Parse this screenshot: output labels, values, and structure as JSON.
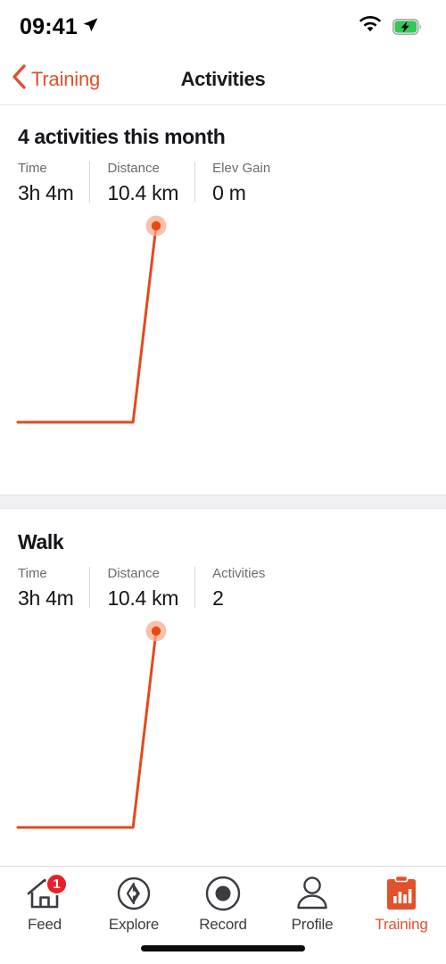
{
  "status_bar": {
    "time": "09:41",
    "location_icon": "location-arrow-icon",
    "wifi_icon": "wifi-icon",
    "battery_icon": "battery-charging-icon"
  },
  "nav": {
    "back_label": "Training",
    "back_icon": "chevron-left-icon",
    "title": "Activities"
  },
  "colors": {
    "accent": "#E1512A",
    "chart_line": "#E24A1D",
    "chart_marker": "#E84B12",
    "chart_marker_halo": "#F7A98B",
    "badge": "#E8202A",
    "battery": "#35C759",
    "text_primary": "#15151A",
    "text_secondary": "#6B6B73",
    "divider": "#D9D9DE",
    "band": "#F1F1F4"
  },
  "sections": [
    {
      "heading": "4 activities this month",
      "stats": [
        {
          "label": "Time",
          "value": "3h 4m"
        },
        {
          "label": "Distance",
          "value": "10.4 km"
        },
        {
          "label": "Elev Gain",
          "value": "0 m"
        }
      ]
    },
    {
      "heading": "Walk",
      "stats": [
        {
          "label": "Time",
          "value": "3h 4m"
        },
        {
          "label": "Distance",
          "value": "10.4 km"
        },
        {
          "label": "Activities",
          "value": "2"
        }
      ]
    }
  ],
  "chart_data": [
    {
      "type": "line",
      "title": "4 activities this month",
      "x": [
        0,
        1,
        2,
        3,
        4,
        5,
        6
      ],
      "values": [
        0,
        0,
        0,
        0,
        0,
        0,
        10.4
      ],
      "ylabel": "",
      "xlabel": "",
      "ylim": [
        0,
        10.4
      ],
      "grid": false,
      "legend": false,
      "marker_points": [
        {
          "x": 6,
          "y": 10.4
        }
      ],
      "line_color": "#E24A1D",
      "marker_color": "#E84B12",
      "marker_halo_color": "#F7A98B"
    },
    {
      "type": "line",
      "title": "Walk",
      "x": [
        0,
        1,
        2,
        3,
        4,
        5,
        6
      ],
      "values": [
        0,
        0,
        0,
        0,
        0,
        0,
        10.4
      ],
      "ylabel": "",
      "xlabel": "",
      "ylim": [
        0,
        10.4
      ],
      "grid": false,
      "legend": false,
      "marker_points": [
        {
          "x": 6,
          "y": 10.4
        }
      ],
      "line_color": "#E24A1D",
      "marker_color": "#E84B12",
      "marker_halo_color": "#F7A98B"
    }
  ],
  "tab_bar": {
    "items": [
      {
        "label": "Feed",
        "icon": "home-icon",
        "badge": "1",
        "active": false
      },
      {
        "label": "Explore",
        "icon": "compass-icon",
        "badge": "",
        "active": false
      },
      {
        "label": "Record",
        "icon": "record-dot-icon",
        "badge": "",
        "active": false
      },
      {
        "label": "Profile",
        "icon": "person-icon",
        "badge": "",
        "active": false
      },
      {
        "label": "Training",
        "icon": "clipboard-chart-icon",
        "badge": "",
        "active": true
      }
    ]
  }
}
